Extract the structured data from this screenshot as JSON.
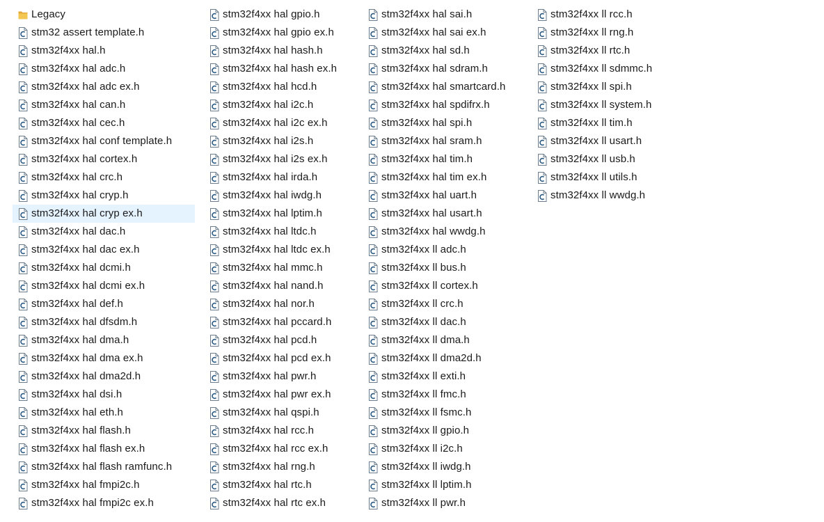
{
  "columns": [
    {
      "items": [
        {
          "type": "folder",
          "name": "Legacy"
        },
        {
          "type": "c",
          "name": "stm32 assert template.h"
        },
        {
          "type": "c",
          "name": "stm32f4xx hal.h"
        },
        {
          "type": "c",
          "name": "stm32f4xx hal adc.h"
        },
        {
          "type": "c",
          "name": "stm32f4xx hal adc ex.h"
        },
        {
          "type": "c",
          "name": "stm32f4xx hal can.h"
        },
        {
          "type": "c",
          "name": "stm32f4xx hal cec.h"
        },
        {
          "type": "c",
          "name": "stm32f4xx hal conf template.h"
        },
        {
          "type": "c",
          "name": "stm32f4xx hal cortex.h"
        },
        {
          "type": "c",
          "name": "stm32f4xx hal crc.h"
        },
        {
          "type": "c",
          "name": "stm32f4xx hal cryp.h"
        },
        {
          "type": "c",
          "name": "stm32f4xx hal cryp ex.h",
          "selected": true
        },
        {
          "type": "c",
          "name": "stm32f4xx hal dac.h"
        },
        {
          "type": "c",
          "name": "stm32f4xx hal dac ex.h"
        },
        {
          "type": "c",
          "name": "stm32f4xx hal dcmi.h"
        },
        {
          "type": "c",
          "name": "stm32f4xx hal dcmi ex.h"
        },
        {
          "type": "c",
          "name": "stm32f4xx hal def.h"
        },
        {
          "type": "c",
          "name": "stm32f4xx hal dfsdm.h"
        },
        {
          "type": "c",
          "name": "stm32f4xx hal dma.h"
        },
        {
          "type": "c",
          "name": "stm32f4xx hal dma ex.h"
        },
        {
          "type": "c",
          "name": "stm32f4xx hal dma2d.h"
        },
        {
          "type": "c",
          "name": "stm32f4xx hal dsi.h"
        },
        {
          "type": "c",
          "name": "stm32f4xx hal eth.h"
        },
        {
          "type": "c",
          "name": "stm32f4xx hal flash.h"
        },
        {
          "type": "c",
          "name": "stm32f4xx hal flash ex.h"
        },
        {
          "type": "c",
          "name": "stm32f4xx hal flash ramfunc.h"
        },
        {
          "type": "c",
          "name": "stm32f4xx hal fmpi2c.h"
        },
        {
          "type": "c",
          "name": "stm32f4xx hal fmpi2c ex.h"
        }
      ]
    },
    {
      "items": [
        {
          "type": "c",
          "name": "stm32f4xx hal gpio.h"
        },
        {
          "type": "c",
          "name": "stm32f4xx hal gpio ex.h"
        },
        {
          "type": "c",
          "name": "stm32f4xx hal hash.h"
        },
        {
          "type": "c",
          "name": "stm32f4xx hal hash ex.h"
        },
        {
          "type": "c",
          "name": "stm32f4xx hal hcd.h"
        },
        {
          "type": "c",
          "name": "stm32f4xx hal i2c.h"
        },
        {
          "type": "c",
          "name": "stm32f4xx hal i2c ex.h"
        },
        {
          "type": "c",
          "name": "stm32f4xx hal i2s.h"
        },
        {
          "type": "c",
          "name": "stm32f4xx hal i2s ex.h"
        },
        {
          "type": "c",
          "name": "stm32f4xx hal irda.h"
        },
        {
          "type": "c",
          "name": "stm32f4xx hal iwdg.h"
        },
        {
          "type": "c",
          "name": "stm32f4xx hal lptim.h"
        },
        {
          "type": "c",
          "name": "stm32f4xx hal ltdc.h"
        },
        {
          "type": "c",
          "name": "stm32f4xx hal ltdc ex.h"
        },
        {
          "type": "c",
          "name": "stm32f4xx hal mmc.h"
        },
        {
          "type": "c",
          "name": "stm32f4xx hal nand.h"
        },
        {
          "type": "c",
          "name": "stm32f4xx hal nor.h"
        },
        {
          "type": "c",
          "name": "stm32f4xx hal pccard.h"
        },
        {
          "type": "c",
          "name": "stm32f4xx hal pcd.h"
        },
        {
          "type": "c",
          "name": "stm32f4xx hal pcd ex.h"
        },
        {
          "type": "c",
          "name": "stm32f4xx hal pwr.h"
        },
        {
          "type": "c",
          "name": "stm32f4xx hal pwr ex.h"
        },
        {
          "type": "c",
          "name": "stm32f4xx hal qspi.h"
        },
        {
          "type": "c",
          "name": "stm32f4xx hal rcc.h"
        },
        {
          "type": "c",
          "name": "stm32f4xx hal rcc ex.h"
        },
        {
          "type": "c",
          "name": "stm32f4xx hal rng.h"
        },
        {
          "type": "c",
          "name": "stm32f4xx hal rtc.h"
        },
        {
          "type": "c",
          "name": "stm32f4xx hal rtc ex.h"
        }
      ]
    },
    {
      "items": [
        {
          "type": "c",
          "name": "stm32f4xx hal sai.h"
        },
        {
          "type": "c",
          "name": "stm32f4xx hal sai ex.h"
        },
        {
          "type": "c",
          "name": "stm32f4xx hal sd.h"
        },
        {
          "type": "c",
          "name": "stm32f4xx hal sdram.h"
        },
        {
          "type": "c",
          "name": "stm32f4xx hal smartcard.h"
        },
        {
          "type": "c",
          "name": "stm32f4xx hal spdifrx.h"
        },
        {
          "type": "c",
          "name": "stm32f4xx hal spi.h"
        },
        {
          "type": "c",
          "name": "stm32f4xx hal sram.h"
        },
        {
          "type": "c",
          "name": "stm32f4xx hal tim.h"
        },
        {
          "type": "c",
          "name": "stm32f4xx hal tim ex.h"
        },
        {
          "type": "c",
          "name": "stm32f4xx hal uart.h"
        },
        {
          "type": "c",
          "name": "stm32f4xx hal usart.h"
        },
        {
          "type": "c",
          "name": "stm32f4xx hal wwdg.h"
        },
        {
          "type": "c",
          "name": "stm32f4xx ll adc.h"
        },
        {
          "type": "c",
          "name": "stm32f4xx ll bus.h"
        },
        {
          "type": "c",
          "name": "stm32f4xx ll cortex.h"
        },
        {
          "type": "c",
          "name": "stm32f4xx ll crc.h"
        },
        {
          "type": "c",
          "name": "stm32f4xx ll dac.h"
        },
        {
          "type": "c",
          "name": "stm32f4xx ll dma.h"
        },
        {
          "type": "c",
          "name": "stm32f4xx ll dma2d.h"
        },
        {
          "type": "c",
          "name": "stm32f4xx ll exti.h"
        },
        {
          "type": "c",
          "name": "stm32f4xx ll fmc.h"
        },
        {
          "type": "c",
          "name": "stm32f4xx ll fsmc.h"
        },
        {
          "type": "c",
          "name": "stm32f4xx ll gpio.h"
        },
        {
          "type": "c",
          "name": "stm32f4xx ll i2c.h"
        },
        {
          "type": "c",
          "name": "stm32f4xx ll iwdg.h"
        },
        {
          "type": "c",
          "name": "stm32f4xx ll lptim.h"
        },
        {
          "type": "c",
          "name": "stm32f4xx ll pwr.h"
        }
      ]
    },
    {
      "items": [
        {
          "type": "c",
          "name": "stm32f4xx ll rcc.h"
        },
        {
          "type": "c",
          "name": "stm32f4xx ll rng.h"
        },
        {
          "type": "c",
          "name": "stm32f4xx ll rtc.h"
        },
        {
          "type": "c",
          "name": "stm32f4xx ll sdmmc.h"
        },
        {
          "type": "c",
          "name": "stm32f4xx ll spi.h"
        },
        {
          "type": "c",
          "name": "stm32f4xx ll system.h"
        },
        {
          "type": "c",
          "name": "stm32f4xx ll tim.h"
        },
        {
          "type": "c",
          "name": "stm32f4xx ll usart.h"
        },
        {
          "type": "c",
          "name": "stm32f4xx ll usb.h"
        },
        {
          "type": "c",
          "name": "stm32f4xx ll utils.h"
        },
        {
          "type": "c",
          "name": "stm32f4xx ll wwdg.h"
        }
      ]
    }
  ],
  "colors": {
    "selection": "#e5f3ff",
    "folder": "#f4c752",
    "icon_outline": "#6b7c8c",
    "icon_letter": "#2b5b84"
  }
}
